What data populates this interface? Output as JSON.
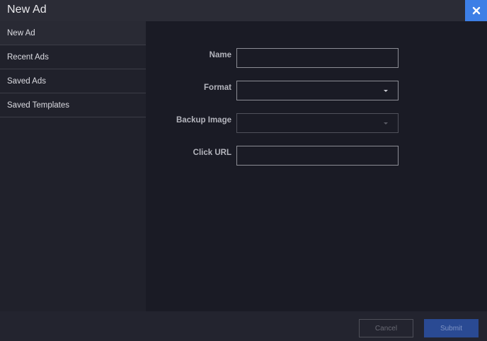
{
  "dialog": {
    "title": "New Ad",
    "close_icon": "close-icon"
  },
  "sidebar": {
    "items": [
      {
        "label": "New Ad",
        "active": true
      },
      {
        "label": "Recent Ads",
        "active": false
      },
      {
        "label": "Saved Ads",
        "active": false
      },
      {
        "label": "Saved Templates",
        "active": false
      }
    ]
  },
  "form": {
    "name": {
      "label": "Name",
      "value": ""
    },
    "format": {
      "label": "Format",
      "value": ""
    },
    "backup_image": {
      "label": "Backup Image",
      "value": "",
      "disabled": true
    },
    "click_url": {
      "label": "Click URL",
      "value": ""
    }
  },
  "footer": {
    "cancel_label": "Cancel",
    "submit_label": "Submit"
  },
  "colors": {
    "accent": "#3d7fe6",
    "submit_bg": "#2a4a93",
    "background": "#1a1b25"
  }
}
